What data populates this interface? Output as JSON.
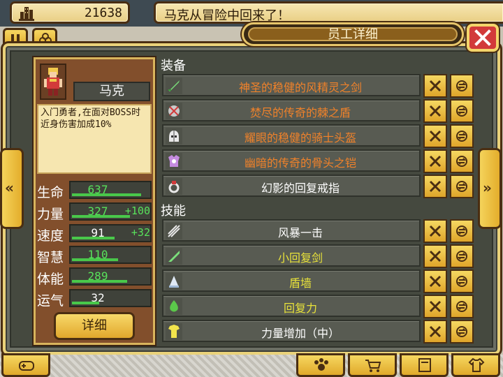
{
  "topbar": {
    "money": "21638",
    "news": "马克从冒险中回来了！"
  },
  "dialog": {
    "title": "员工详细",
    "close_icon": "close-icon"
  },
  "employee": {
    "name": "马克",
    "description": "入门勇者,在面对BOSS时近身伤害加成10%",
    "stats": [
      {
        "label": "生命",
        "value": "637",
        "bonus": "",
        "fill": 0.9,
        "color": "#58e25b"
      },
      {
        "label": "力量",
        "value": "327",
        "bonus": "+100",
        "fill": 0.75,
        "color": "#58e25b"
      },
      {
        "label": "速度",
        "value": "91",
        "bonus": "+32",
        "fill": 0.55,
        "color": "#ffffff"
      },
      {
        "label": "智慧",
        "value": "110",
        "bonus": "",
        "fill": 0.6,
        "color": "#58e25b"
      },
      {
        "label": "体能",
        "value": "289",
        "bonus": "",
        "fill": 0.72,
        "color": "#58e25b"
      },
      {
        "label": "运气",
        "value": "32",
        "bonus": "",
        "fill": 0.35,
        "color": "#ffffff"
      }
    ],
    "detail_button": "详细"
  },
  "equipment": {
    "heading": "装备",
    "items": [
      {
        "name": "神圣的稳健的风精灵之剑",
        "color": "#f0822a",
        "icon": "sword-icon"
      },
      {
        "name": "焚尽的传奇的棘之盾",
        "color": "#f0822a",
        "icon": "shield-icon"
      },
      {
        "name": "耀眼的稳健的骑士头盔",
        "color": "#f0822a",
        "icon": "helmet-icon"
      },
      {
        "name": "幽暗的传奇的骨头之铠",
        "color": "#f0822a",
        "icon": "armor-icon"
      },
      {
        "name": "幻影的回复戒指",
        "color": "#ffffff",
        "icon": "ring-icon"
      }
    ]
  },
  "skills": {
    "heading": "技能",
    "items": [
      {
        "name": "风暴一击",
        "color": "#ffffff",
        "icon": "storm-strike-icon"
      },
      {
        "name": "小回复剑",
        "color": "#e8e23a",
        "icon": "heal-sword-icon"
      },
      {
        "name": "盾墙",
        "color": "#e8e23a",
        "icon": "shield-wall-icon"
      },
      {
        "name": "回复力",
        "color": "#e8e23a",
        "icon": "recovery-icon"
      },
      {
        "name": "力量增加（中）",
        "color": "#ffffff",
        "icon": "strength-up-icon"
      }
    ]
  }
}
